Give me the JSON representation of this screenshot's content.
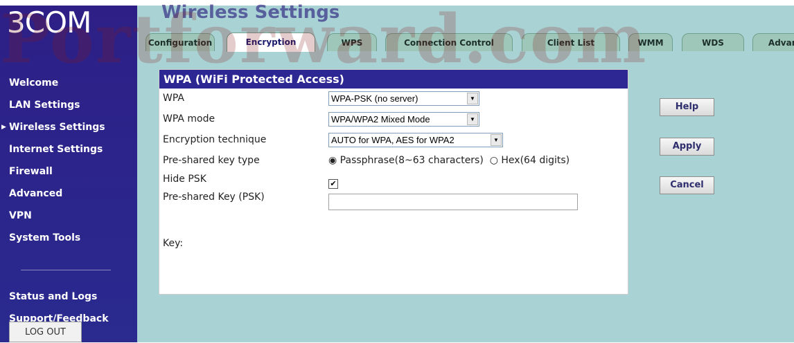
{
  "brand": {
    "logo": "3COM"
  },
  "page": {
    "title": "Wireless Settings"
  },
  "watermark": "Portforward.com",
  "sidebar": {
    "items": [
      {
        "label": "Welcome"
      },
      {
        "label": "LAN Settings"
      },
      {
        "label": "Wireless Settings",
        "selected": true,
        "arrow": "▶"
      },
      {
        "label": "Internet Settings"
      },
      {
        "label": "Firewall"
      },
      {
        "label": "Advanced"
      },
      {
        "label": "VPN"
      },
      {
        "label": "System Tools"
      }
    ],
    "items2": [
      {
        "label": "Status and Logs"
      },
      {
        "label": "Support/Feedback"
      }
    ],
    "logout_label": "LOG OUT"
  },
  "tabs": [
    {
      "label": "Configuration"
    },
    {
      "label": "Encryption",
      "active": true
    },
    {
      "label": "WPS"
    },
    {
      "label": "Connection Control"
    },
    {
      "label": "Client List"
    },
    {
      "label": "WMM"
    },
    {
      "label": "WDS"
    },
    {
      "label": "Advanced"
    }
  ],
  "panel": {
    "title": "WPA (WiFi Protected Access)",
    "wpa": {
      "label": "WPA",
      "value": "WPA-PSK (no server)"
    },
    "wpa_mode": {
      "label": "WPA mode",
      "value": "WPA/WPA2 Mixed Mode"
    },
    "encryption": {
      "label": "Encryption technique",
      "value": "AUTO for WPA, AES for WPA2"
    },
    "psk_type": {
      "label": "Pre-shared key type",
      "option1": "Passphrase(8~63 characters)",
      "option2": "Hex(64 digits)",
      "selected": "Passphrase(8~63 characters)"
    },
    "hide_psk": {
      "label": "Hide PSK",
      "checked": true
    },
    "psk": {
      "label": "Pre-shared Key (PSK)",
      "value": ""
    },
    "key_label": "Key:"
  },
  "buttons": {
    "help": "Help",
    "apply": "Apply",
    "cancel": "Cancel"
  },
  "colors": {
    "sidebar": "#2d1f86",
    "main_bg": "#a9d2d4",
    "panel_header": "#2c2793"
  }
}
